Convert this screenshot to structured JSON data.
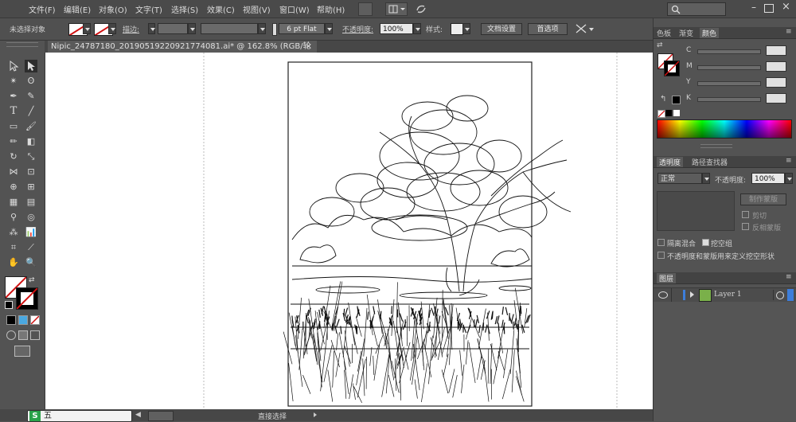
{
  "menu": [
    "文件(F)",
    "编辑(E)",
    "对象(O)",
    "文字(T)",
    "选择(S)",
    "效果(C)",
    "视图(V)",
    "窗口(W)",
    "帮助(H)"
  ],
  "control_bar": {
    "selection_status": "未选择对象",
    "stroke_label": "描边:",
    "brush_value": "6 pt Flat",
    "opacity_label": "不透明度:",
    "opacity_value": "100%",
    "style_label": "样式:",
    "doc_settings_button": "文档设置",
    "preferences_button": "首选项"
  },
  "document_tab": {
    "title": "Nipic_24787180_20190519220921774081.ai* @ 162.8% (RGB/轮廓)",
    "close": "×"
  },
  "color_panel": {
    "tabs": [
      "色板",
      "渐变",
      "颜色"
    ],
    "channels": [
      "C",
      "M",
      "Y",
      "K"
    ]
  },
  "transparency_panel": {
    "tabs": [
      "透明度",
      "路径查找器"
    ],
    "blend_mode": "正常",
    "opacity_label": "不透明度:",
    "opacity_value": "100%",
    "make_mask_button": "制作蒙版",
    "clip_label": "剪切",
    "invert_mask_label": "反相蒙版",
    "isolate_blending_label": "隔离混合",
    "knockout_group_label": "挖空组",
    "opacity_mask_shape_label": "不透明度和蒙版用来定义挖空形状"
  },
  "layers_panel": {
    "title": "图层",
    "layer_name": "Layer 1"
  },
  "status_bar": {
    "tool_name": "直接选择"
  },
  "colors": {
    "stroke_red": "#d01010",
    "panel_bg": "#535353",
    "accent_blue": "#3d7edb",
    "label_orange": "#f08a24"
  }
}
